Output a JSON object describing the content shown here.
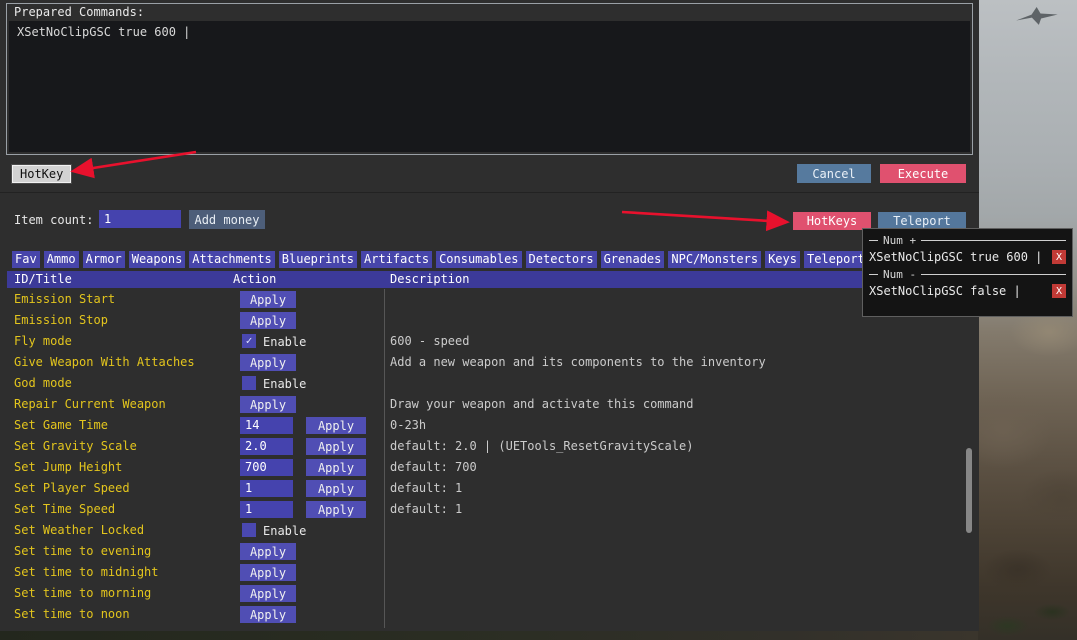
{
  "prepared_commands": {
    "title": "Prepared Commands:",
    "value": "XSetNoClipGSC true 600 |",
    "hotkey_button": "HotKey",
    "cancel_button": "Cancel",
    "execute_button": "Execute"
  },
  "toolbar": {
    "item_count_label": "Item count:",
    "item_count_value": "1",
    "add_money_button": "Add money",
    "hotkeys_button": "HotKeys",
    "teleport_button": "Teleport"
  },
  "tabs": [
    "Fav",
    "Ammo",
    "Armor",
    "Weapons",
    "Attachments",
    "Blueprints",
    "Artifacts",
    "Consumables",
    "Detectors",
    "Grenades",
    "NPC/Monsters",
    "Keys",
    "Teleport"
  ],
  "table": {
    "headers": [
      "ID/Title",
      "Action",
      "Description"
    ],
    "rows": [
      {
        "title": "Emission Start",
        "action": "apply",
        "button": "Apply",
        "description": ""
      },
      {
        "title": "Emission Stop",
        "action": "apply",
        "button": "Apply",
        "description": ""
      },
      {
        "title": "Fly mode",
        "action": "checkbox",
        "label": "Enable",
        "checked": true,
        "description": "600 - speed"
      },
      {
        "title": "Give Weapon With Attaches",
        "action": "apply",
        "button": "Apply",
        "description": "Add a new weapon and its components to the inventory"
      },
      {
        "title": "God mode",
        "action": "checkbox",
        "label": "Enable",
        "checked": false,
        "description": ""
      },
      {
        "title": "Repair Current Weapon",
        "action": "apply",
        "button": "Apply",
        "description": "Draw your weapon and activate this command"
      },
      {
        "title": "Set Game Time",
        "action": "input_apply",
        "value": "14",
        "button": "Apply",
        "description": "0-23h"
      },
      {
        "title": "Set Gravity Scale",
        "action": "input_apply",
        "value": "2.0",
        "button": "Apply",
        "description": "default: 2.0 | (UETools_ResetGravityScale)"
      },
      {
        "title": "Set Jump Height",
        "action": "input_apply",
        "value": "700",
        "button": "Apply",
        "description": "default: 700"
      },
      {
        "title": "Set Player Speed",
        "action": "input_apply",
        "value": "1",
        "button": "Apply",
        "description": "default: 1"
      },
      {
        "title": "Set Time Speed",
        "action": "input_apply",
        "value": "1",
        "button": "Apply",
        "description": "default: 1"
      },
      {
        "title": "Set Weather Locked",
        "action": "checkbox",
        "label": "Enable",
        "checked": false,
        "description": ""
      },
      {
        "title": "Set time to evening",
        "action": "apply",
        "button": "Apply",
        "description": ""
      },
      {
        "title": "Set time to midnight",
        "action": "apply",
        "button": "Apply",
        "description": ""
      },
      {
        "title": "Set time to morning",
        "action": "apply",
        "button": "Apply",
        "description": ""
      },
      {
        "title": "Set time to noon",
        "action": "apply",
        "button": "Apply",
        "description": ""
      }
    ]
  },
  "hotkeys_popup": {
    "bindings": [
      {
        "key": "Num +",
        "command": "XSetNoClipGSC true 600 |",
        "remove_label": "X"
      },
      {
        "key": "Num -",
        "command": "XSetNoClipGSC false |",
        "remove_label": "X"
      }
    ]
  },
  "colors": {
    "accent_purple": "#4745aa",
    "accent_pink": "#e0516f",
    "accent_blue": "#567a9e",
    "title_yellow": "#e3c51d",
    "arrow_red": "#e8112d"
  }
}
